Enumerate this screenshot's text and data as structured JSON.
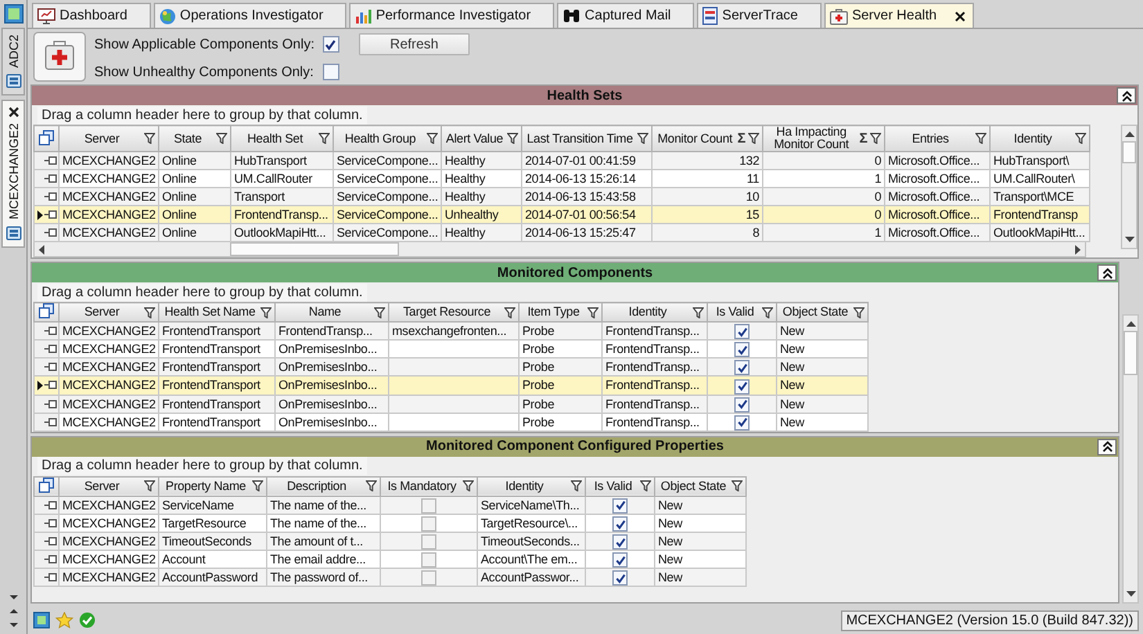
{
  "left_panel": {
    "tabs": [
      {
        "label": "ADC2",
        "selected": false
      },
      {
        "label": "MCEXCHANGE2",
        "selected": true
      }
    ]
  },
  "tabs": [
    {
      "label": "Dashboard",
      "selected": false
    },
    {
      "label": "Operations Investigator",
      "selected": false
    },
    {
      "label": "Performance Investigator",
      "selected": false
    },
    {
      "label": "Captured Mail",
      "selected": false
    },
    {
      "label": "ServerTrace",
      "selected": false
    },
    {
      "label": "Server Health",
      "selected": true
    }
  ],
  "toolbar": {
    "options": [
      {
        "label": "Show Applicable Components Only:",
        "checked": true
      },
      {
        "label": "Show Unhealthy Components Only:",
        "checked": false
      }
    ],
    "refresh_button": "Refresh"
  },
  "sections": [
    {
      "title": "Health Sets",
      "color": "#a87c80",
      "group_hint": "Drag a column header here to group by that column.",
      "columns": [
        {
          "label": "Server",
          "kind": "text"
        },
        {
          "label": "State",
          "kind": "text"
        },
        {
          "label": "Health Set",
          "kind": "text"
        },
        {
          "label": "Health Group",
          "kind": "text"
        },
        {
          "label": "Alert Value",
          "kind": "text"
        },
        {
          "label": "Last Transition Time",
          "kind": "text"
        },
        {
          "label": "Monitor Count",
          "kind": "number",
          "sum_mark": "Σ"
        },
        {
          "label": "Ha Impacting Monitor Count",
          "kind": "number",
          "sum_mark": "Σ"
        },
        {
          "label": "Entries",
          "kind": "text"
        },
        {
          "label": "Identity",
          "kind": "text"
        }
      ],
      "rows": [
        {
          "selected": false,
          "cells": [
            "MCEXCHANGE2",
            "Online",
            "HubTransport",
            "ServiceCompone...",
            "Healthy",
            "2014-07-01 00:41:59",
            "132",
            "0",
            "Microsoft.Office...",
            "HubTransport\\"
          ]
        },
        {
          "selected": false,
          "cells": [
            "MCEXCHANGE2",
            "Online",
            "UM.CallRouter",
            "ServiceCompone...",
            "Healthy",
            "2014-06-13 15:26:14",
            "11",
            "1",
            "Microsoft.Office...",
            "UM.CallRouter\\"
          ]
        },
        {
          "selected": false,
          "cells": [
            "MCEXCHANGE2",
            "Online",
            "Transport",
            "ServiceCompone...",
            "Healthy",
            "2014-06-13 15:43:58",
            "10",
            "0",
            "Microsoft.Office...",
            "Transport\\MCE"
          ]
        },
        {
          "selected": true,
          "cells": [
            "MCEXCHANGE2",
            "Online",
            "FrontendTransp...",
            "ServiceCompone...",
            "Unhealthy",
            "2014-07-01 00:56:54",
            "15",
            "0",
            "Microsoft.Office...",
            "FrontendTransp"
          ]
        },
        {
          "selected": false,
          "cells": [
            "MCEXCHANGE2",
            "Online",
            "OutlookMapiHtt...",
            "ServiceCompone...",
            "Healthy",
            "2014-06-13 15:25:47",
            "8",
            "1",
            "Microsoft.Office...",
            "OutlookMapiHtt..."
          ]
        }
      ]
    },
    {
      "title": "Monitored Components",
      "color": "#6fae77",
      "group_hint": "Drag a column header here to group by that column.",
      "columns": [
        {
          "label": "Server",
          "kind": "text"
        },
        {
          "label": "Health Set Name",
          "kind": "text"
        },
        {
          "label": "Name",
          "kind": "text"
        },
        {
          "label": "Target Resource",
          "kind": "text"
        },
        {
          "label": "Item Type",
          "kind": "text"
        },
        {
          "label": "Identity",
          "kind": "text"
        },
        {
          "label": "Is Valid",
          "kind": "check"
        },
        {
          "label": "Object State",
          "kind": "text"
        }
      ],
      "rows": [
        {
          "selected": false,
          "cells": [
            "MCEXCHANGE2",
            "FrontendTransport",
            "FrontendTransp...",
            "msexchangefronten...",
            "Probe",
            "FrontendTransp...",
            true,
            "New"
          ]
        },
        {
          "selected": false,
          "cells": [
            "MCEXCHANGE2",
            "FrontendTransport",
            "OnPremisesInbo...",
            null,
            "Probe",
            "FrontendTransp...",
            true,
            "New"
          ]
        },
        {
          "selected": false,
          "cells": [
            "MCEXCHANGE2",
            "FrontendTransport",
            "OnPremisesInbo...",
            null,
            "Probe",
            "FrontendTransp...",
            true,
            "New"
          ]
        },
        {
          "selected": true,
          "cells": [
            "MCEXCHANGE2",
            "FrontendTransport",
            "OnPremisesInbo...",
            null,
            "Probe",
            "FrontendTransp...",
            true,
            "New"
          ]
        },
        {
          "selected": false,
          "cells": [
            "MCEXCHANGE2",
            "FrontendTransport",
            "OnPremisesInbo...",
            null,
            "Probe",
            "FrontendTransp...",
            true,
            "New"
          ]
        },
        {
          "selected": false,
          "cells": [
            "MCEXCHANGE2",
            "FrontendTransport",
            "OnPremisesInbo...",
            null,
            "Probe",
            "FrontendTransp...",
            true,
            "New"
          ]
        }
      ]
    },
    {
      "title": "Monitored Component Configured Properties",
      "color": "#a3a66a",
      "group_hint": "Drag a column header here to group by that column.",
      "columns": [
        {
          "label": "Server",
          "kind": "text"
        },
        {
          "label": "Property Name",
          "kind": "text"
        },
        {
          "label": "Description",
          "kind": "text"
        },
        {
          "label": "Is Mandatory",
          "kind": "check"
        },
        {
          "label": "Identity",
          "kind": "text"
        },
        {
          "label": "Is Valid",
          "kind": "check"
        },
        {
          "label": "Object State",
          "kind": "text"
        }
      ],
      "rows": [
        {
          "selected": false,
          "cells": [
            "MCEXCHANGE2",
            "ServiceName",
            "The name of the...",
            false,
            "ServiceName\\Th...",
            true,
            "New"
          ]
        },
        {
          "selected": false,
          "cells": [
            "MCEXCHANGE2",
            "TargetResource",
            "The name of the...",
            false,
            "TargetResource\\...",
            true,
            "New"
          ]
        },
        {
          "selected": false,
          "cells": [
            "MCEXCHANGE2",
            "TimeoutSeconds",
            "The amount of t...",
            false,
            "TimeoutSeconds...",
            true,
            "New"
          ]
        },
        {
          "selected": false,
          "cells": [
            "MCEXCHANGE2",
            "Account",
            "The email addre...",
            false,
            "Account\\The  em...",
            true,
            "New"
          ]
        },
        {
          "selected": false,
          "cells": [
            "MCEXCHANGE2",
            "AccountPassword",
            "The password of...",
            false,
            "AccountPasswor...",
            true,
            "New"
          ]
        }
      ]
    }
  ],
  "status_bar": {
    "server_info": "MCEXCHANGE2 (Version 15.0 (Build 847.32))"
  }
}
